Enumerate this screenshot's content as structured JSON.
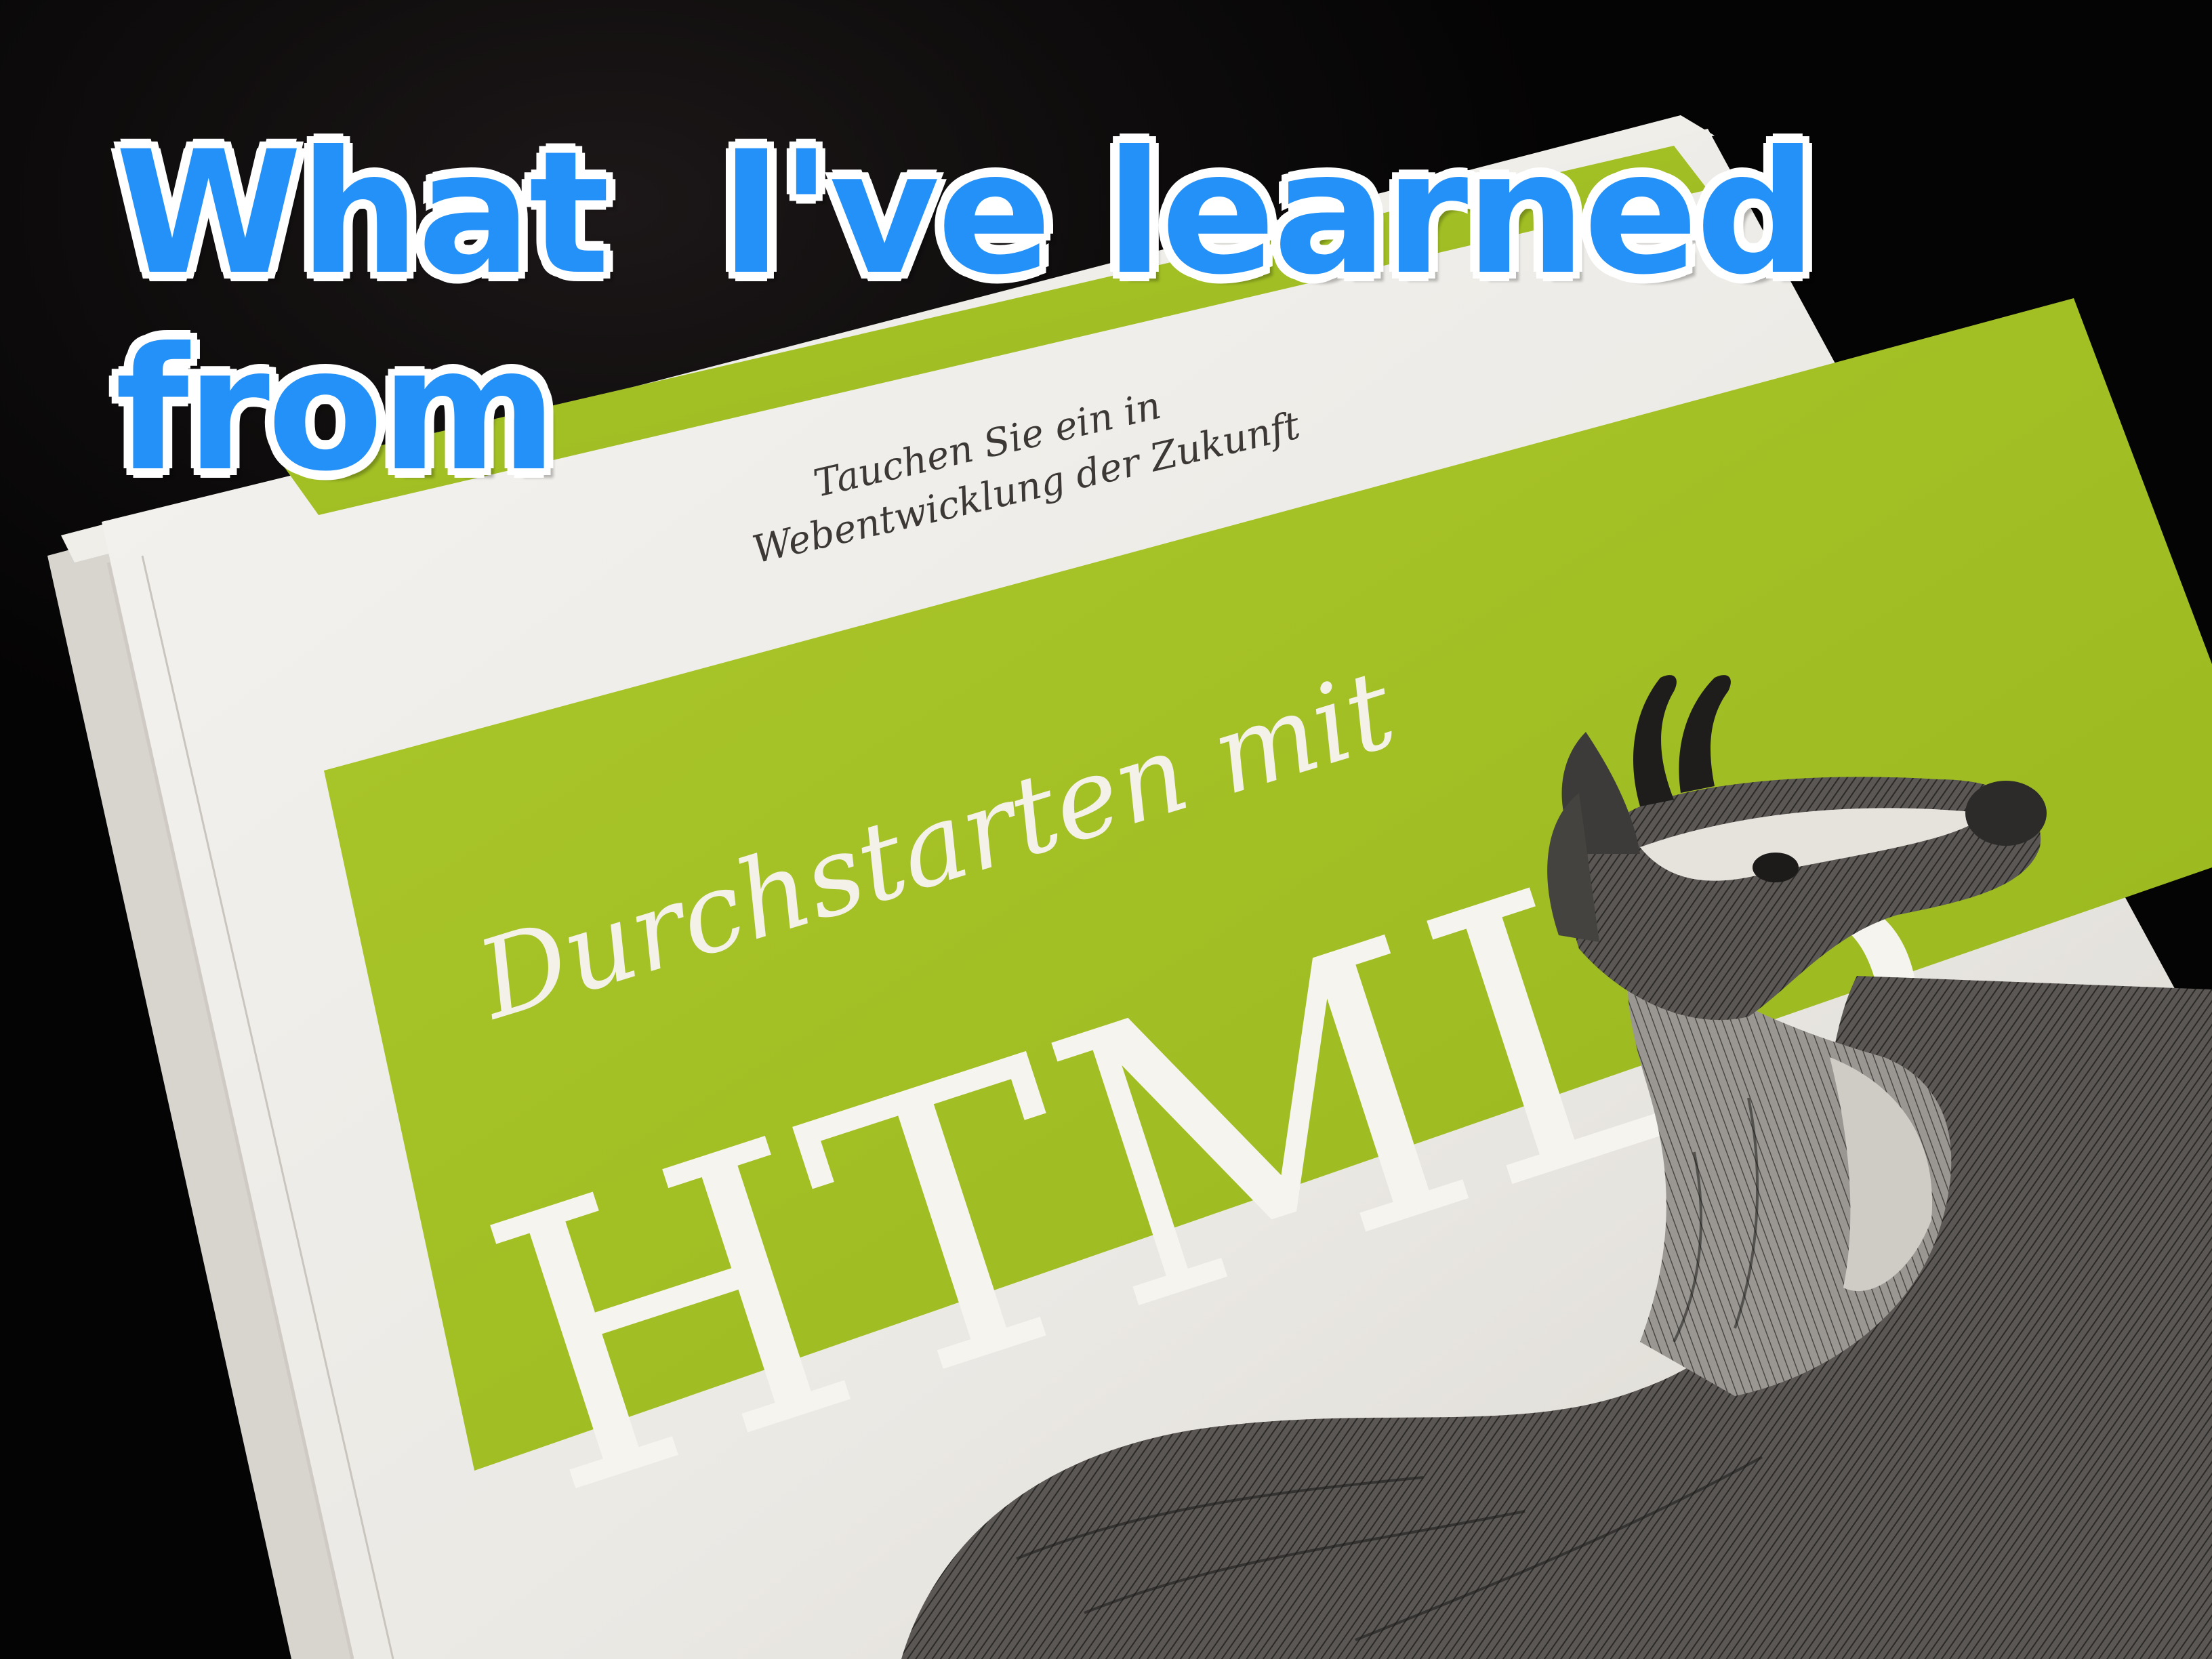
{
  "overlay": {
    "line1": "What  I've learned",
    "line2": "from",
    "color": "#2391f8"
  },
  "cover": {
    "tagline_line1": "Tauchen Sie ein in",
    "tagline_line2": "Webentwicklung der Zukunft",
    "subtitle": "Durchstarten mit",
    "title": "HTML5",
    "accent_color": "#a6c225",
    "illustration": "chamois-engraving"
  }
}
